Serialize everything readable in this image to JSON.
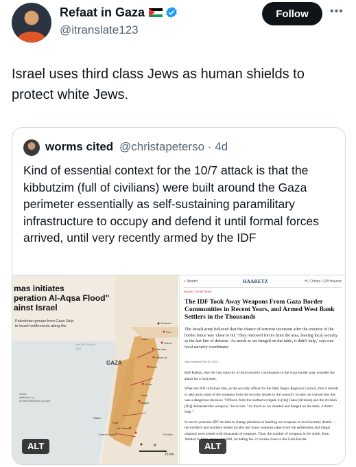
{
  "tweet": {
    "author_name": "Refaat in Gaza",
    "author_handle": "@itranslate123",
    "follow_label": "Follow",
    "more_label": "•••",
    "text": "Israel uses third class Jews as human shields to protect white Jews.",
    "icons": {
      "flag": "palestine-flag-icon",
      "verified": "verified-badge-icon",
      "more": "more-options-icon"
    },
    "colors": {
      "verified": "#1d9bf0",
      "follow_bg": "#0f1419"
    }
  },
  "quote": {
    "author_name": "worms cited",
    "author_handle_time": "@christapeterso · 4d",
    "text": "Kind of essential context for the 10/7 attack is that the kibbutzim (full of civilians) were built around the Gaza perimeter essentially as self-sustaining paramilitary infrastructure to occupy and defend it until formal forces arrived, until very recently armed by the IDF"
  },
  "media": {
    "alt_label": "ALT",
    "map": {
      "title": "mas initiates\nperation Al-Aqsa Flood\"\nainst Israel",
      "subtitle": "Palestinian groups from Gaza Strip\nte Israeli settlements along the",
      "sea_label": "Mediterranean\nSea",
      "gaza_label": "GAZA",
      "legend": "Areas\ninfiltrated by\narmed Palestinian groups",
      "places": [
        "Ashkelon",
        "Erez",
        "Sderot",
        "Kfar Aza",
        "Nahal Oz",
        "Be'eri",
        "Re'im",
        "Nirim",
        "Magen",
        "Sufa",
        "Nir Yitzhak",
        "Kerem Shalom",
        "Tze'elim",
        "Rafah",
        "Nuseirat",
        "Gaza",
        "Khan Yunis",
        "Nirim",
        "Ofakim"
      ],
      "scale": "15 km",
      "north": "N"
    },
    "article": {
      "search": "Search",
      "logo": "HAARETZ",
      "links": "Hi, Christa | Gift Haaretz",
      "crumb": "Haaretz | Israel News",
      "headline": "The IDF Took Away Weapons From Gaza Border Communities in Recent Years, and Armed West Bank Settlers in the Thousands",
      "dek": "The Israeli army believed that the chance of terrorist incursion after the erection of the border fence was 'close to nil.' They removed forces from the area, leaving local security as the last line of defense. 'As much as we banged on the table, it didn't help,' says one local security coordinator",
      "byline": "Yaniv Kubovich  Oct 20, 2023",
      "paragraphs": [
        "Rafi Babian, like the vast majority of local security coordinators in the Gaza border area, sounded the alarm for a long time.",
        "When the IDF informed him, as the security officer for the Sdot Negev Regional Council, that it intends to take away most of the weapons from the security details in the council's locales, he warned that this was a dangerous decision. \"Officers from the northern brigade in [the] Gaza [division] and the division [HQ] demanded the weapons,\" he recalls. \"As much as we shouted and banged on the table, it didn't help.\"",
        "In recent years the IDF decided to change priorities in handing out weapons to local security details — the northern and southern border locales had many weapons taken from the settlements and illegal outposts were armed with thousands of weapons. Thus, the number of weapons in the south, from Ashdod to Eilat, dropped to 800, including the 52 locales close to the Gaza Border."
      ]
    }
  }
}
